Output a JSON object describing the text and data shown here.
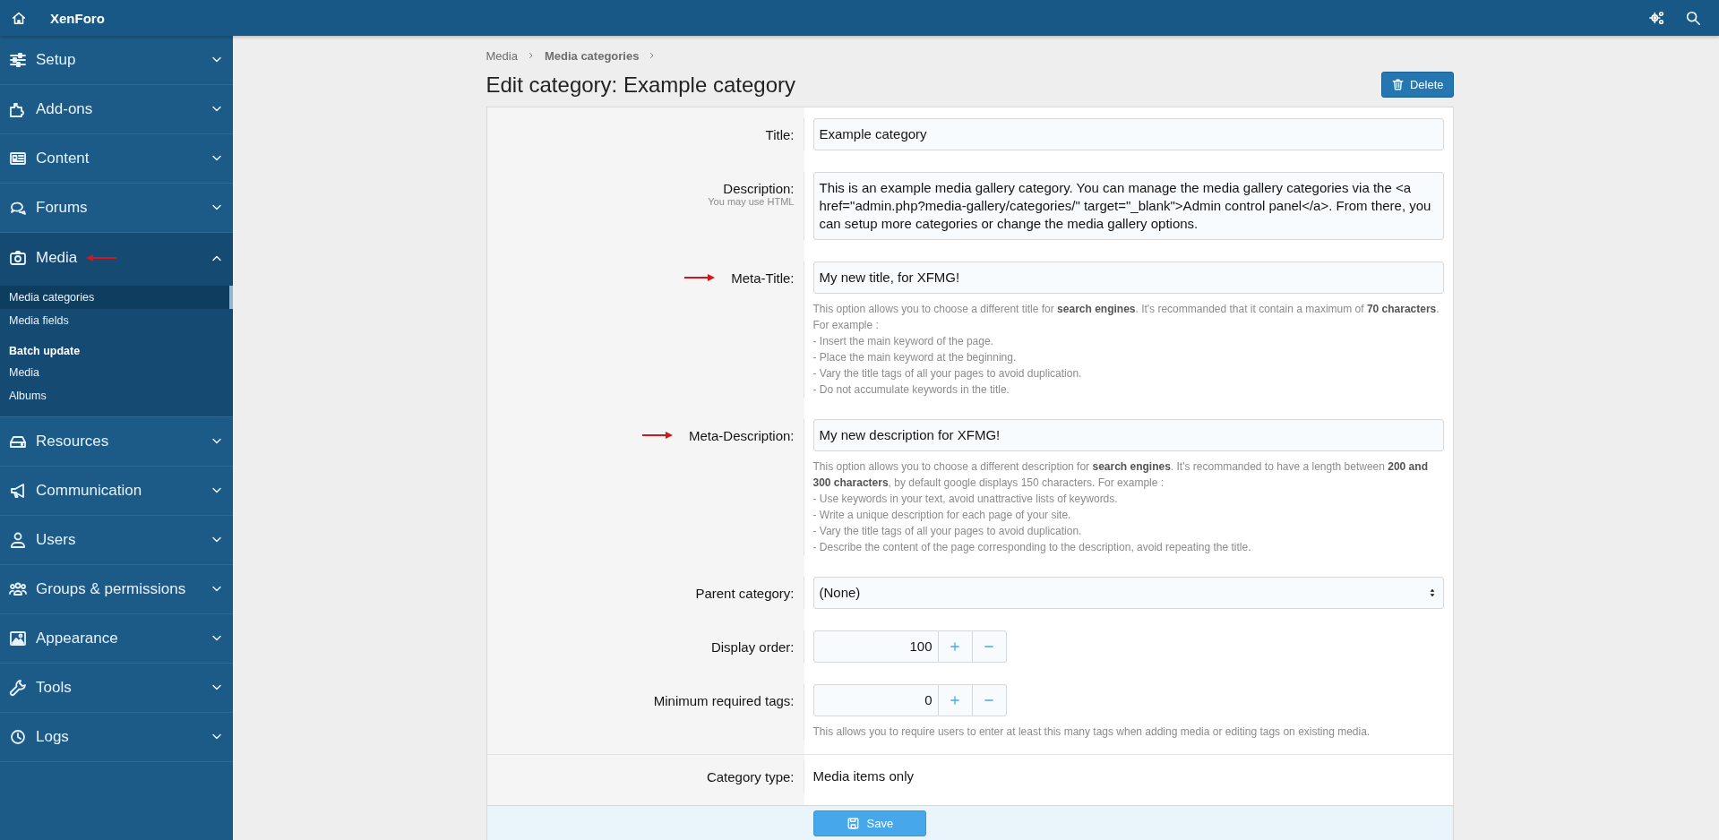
{
  "header": {
    "title": "XenForo"
  },
  "sidebar": {
    "items": [
      {
        "label": "Setup",
        "expanded": false,
        "annotated": false
      },
      {
        "label": "Add-ons",
        "expanded": false,
        "annotated": false
      },
      {
        "label": "Content",
        "expanded": false,
        "annotated": false
      },
      {
        "label": "Forums",
        "expanded": false,
        "annotated": false
      },
      {
        "label": "Media",
        "expanded": true,
        "annotated": true,
        "children": [
          {
            "kind": "link",
            "label": "Media categories",
            "selected": true
          },
          {
            "kind": "link",
            "label": "Media fields",
            "selected": false
          },
          {
            "kind": "heading",
            "label": "Batch update"
          },
          {
            "kind": "link",
            "label": "Media",
            "selected": false
          },
          {
            "kind": "link",
            "label": "Albums",
            "selected": false
          }
        ]
      },
      {
        "label": "Resources",
        "expanded": false,
        "annotated": false
      },
      {
        "label": "Communication",
        "expanded": false,
        "annotated": false
      },
      {
        "label": "Users",
        "expanded": false,
        "annotated": false
      },
      {
        "label": "Groups & permissions",
        "expanded": false,
        "annotated": false
      },
      {
        "label": "Appearance",
        "expanded": false,
        "annotated": false
      },
      {
        "label": "Tools",
        "expanded": false,
        "annotated": false
      },
      {
        "label": "Logs",
        "expanded": false,
        "annotated": false
      }
    ]
  },
  "breadcrumb": [
    {
      "label": "Media",
      "current": false
    },
    {
      "label": "Media categories",
      "current": true
    }
  ],
  "page_title": "Edit category: Example category",
  "delete_button": "Delete",
  "form": {
    "rows": [
      {
        "kind": "text",
        "label": "Title:",
        "value": "Example category",
        "annotated": false
      },
      {
        "kind": "textarea",
        "label": "Description:",
        "hint": "You may use HTML",
        "value": "This is an example media gallery category. You can manage the media gallery categories via the <a href=\"admin.php?media-gallery/categories/\" target=\"_blank\">Admin control panel</a>. From there, you can setup more categories or change the media gallery options.",
        "annotated": false
      },
      {
        "kind": "text",
        "label": "Meta-Title:",
        "value": "My new title, for XFMG!",
        "annotated": true,
        "explain": [
          "This option allows you to choose a different title for **search engines**. It's recommanded that it contain a maximum of **70 characters**. For example :",
          "- Insert the main keyword of the page.",
          "- Place the main keyword at the beginning.",
          "- Vary the title tags of all your pages to avoid duplication.",
          "- Do not accumulate keywords in the title."
        ]
      },
      {
        "kind": "text",
        "label": "Meta-Description:",
        "value": "My new description for XFMG!",
        "annotated": true,
        "explain": [
          "This option allows you to choose a different description for **search engines**. It's recommanded to have a length between **200 and 300 characters**, by default google displays 150 characters. For example :",
          "- Use keywords in your text, avoid unattractive lists of keywords.",
          "- Write a unique description for each page of your site.",
          "- Vary the title tags of all your pages to avoid duplication.",
          "- Describe the content of the page corresponding to the description, avoid repeating the title."
        ]
      },
      {
        "kind": "select",
        "label": "Parent category:",
        "value": "(None)",
        "annotated": false
      },
      {
        "kind": "number",
        "label": "Display order:",
        "value": "100",
        "annotated": false
      },
      {
        "kind": "number",
        "label": "Minimum required tags:",
        "value": "0",
        "annotated": false,
        "explain": [
          "This allows you to require users to enter at least this many tags when adding media or editing tags on existing media."
        ]
      },
      {
        "kind": "static",
        "label": "Category type:",
        "value": "Media items only",
        "annotated": false
      }
    ]
  },
  "save_button": "Save"
}
